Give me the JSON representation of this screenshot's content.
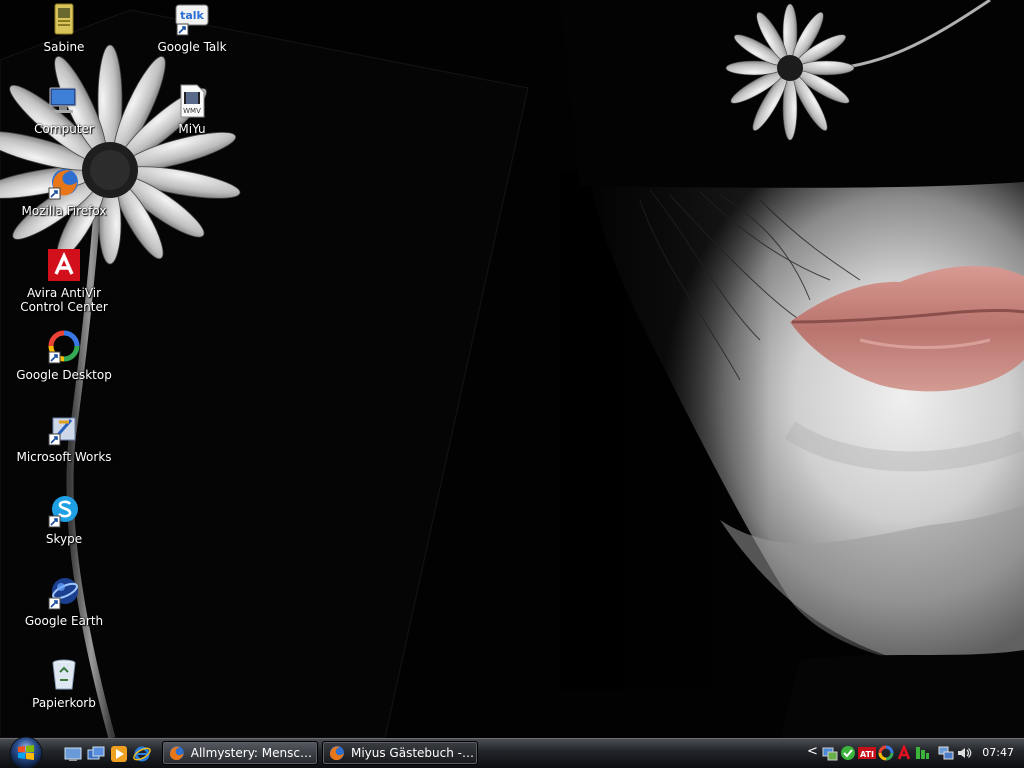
{
  "desktop": {
    "icons": [
      {
        "label": "Sabine",
        "icon": "user-folder-icon"
      },
      {
        "label": "Google Talk",
        "icon": "google-talk-icon"
      },
      {
        "label": "Computer",
        "icon": "computer-icon"
      },
      {
        "label": "MiYu",
        "icon": "wmv-file-icon"
      },
      {
        "label": "Mozilla Firefox",
        "icon": "firefox-icon"
      },
      {
        "label": "Avira AntiVir Control Center",
        "icon": "avira-icon"
      },
      {
        "label": "Google Desktop",
        "icon": "google-desktop-icon"
      },
      {
        "label": "Microsoft Works",
        "icon": "microsoft-works-icon"
      },
      {
        "label": "Skype",
        "icon": "skype-icon"
      },
      {
        "label": "Google Earth",
        "icon": "google-earth-icon"
      },
      {
        "label": "Papierkorb",
        "icon": "recycle-bin-icon"
      }
    ],
    "wmv_badge": "WMV",
    "talk_badge": "talk"
  },
  "taskbar": {
    "quick_launch": [
      "show-desktop-icon",
      "switch-windows-icon",
      "media-player-icon",
      "internet-explorer-icon"
    ],
    "tasks": [
      {
        "label": "Allmystery: Mensch...",
        "icon": "firefox-icon"
      },
      {
        "label": "Miyus Gästebuch - ...",
        "icon": "firefox-icon"
      }
    ],
    "tray": {
      "chevron": "<",
      "icons": [
        "network-manager-icon",
        "green-status-icon",
        "ati-icon",
        "google-desktop-tray-icon",
        "avira-tray-icon",
        "monitor-tray-icon",
        "network-tray-icon",
        "volume-icon"
      ],
      "ati_text": "ATI",
      "clock": "07:47"
    }
  },
  "colors": {
    "lips": "#c98a84",
    "taskbar": "#1a1c20"
  }
}
